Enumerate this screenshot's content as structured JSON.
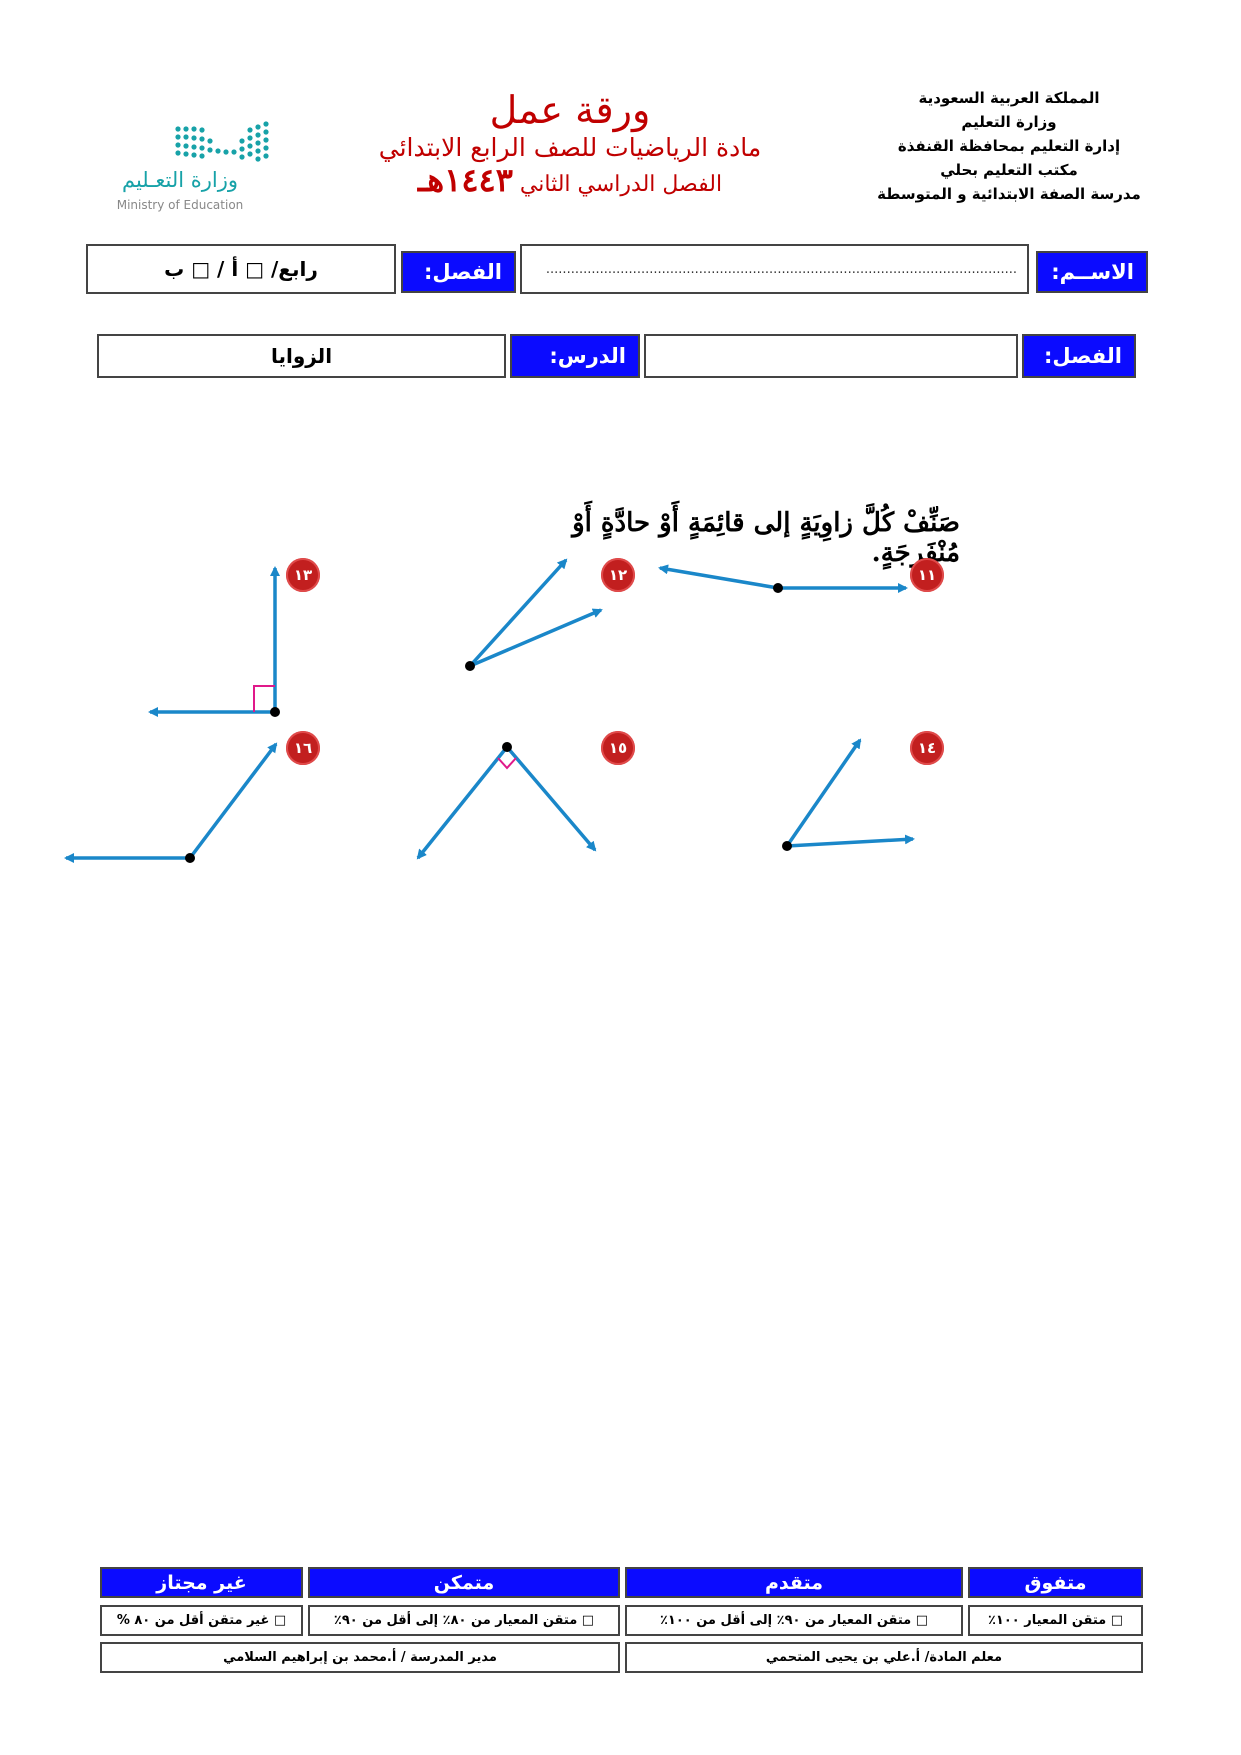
{
  "header": {
    "school_lines": [
      "المملكة العربية السعودية",
      "وزارة التعليم",
      "إدارة التعليم بمحافظة القنفذة",
      "مكتب التعليم بحلي",
      "مدرسة الصفة الابتدائية و المتوسطة"
    ],
    "worksheet_title": "ورقة عمل",
    "subject_line": "مادة الرياضيات للصف الرابع الابتدائي",
    "semester_text": "الفصل الدراسي الثاني",
    "year_text": "١٤٤٣هـ",
    "logo_ar": "وزارة التعـليم",
    "logo_en": "Ministry of Education"
  },
  "form": {
    "name_label": "الاســم:",
    "name_value": "..................................................................................................................",
    "class_label": "الفصل:",
    "class_value": "رابع/ □ أ  /  □ ب",
    "semester_label": "الفصل:",
    "semester_value": "",
    "lesson_label": "الدرس:",
    "lesson_value": "الزوايا"
  },
  "exercise": {
    "instruction": "صَنِّفْ كُلَّ زاوِيَةٍ إلى قائِمَةٍ أَوْ حادَّةٍ أَوْ مُنْفَرِجَةٍ.",
    "items": [
      {
        "number": "١١"
      },
      {
        "number": "١٢"
      },
      {
        "number": "١٣"
      },
      {
        "number": "١٤"
      },
      {
        "number": "١٥"
      },
      {
        "number": "١٦"
      }
    ],
    "arrow_color": "#1a87c9",
    "right_angle_color": "#e0198a"
  },
  "assessment": {
    "headers": [
      "متفوق",
      "متقدم",
      "متمكن",
      "غير مجتاز"
    ],
    "criteria": [
      "□ متقن المعيار ١٠٠٪",
      "□ متقن المعيار من ٩٠٪  إلى أقل من ١٠٠٪",
      "□ متقن المعيار من ٨٠٪ إلى أقل من ٩٠٪",
      "□ غير متقن أقل من ٨٠ %"
    ],
    "teacher": "معلم المادة/ أ.علي بن يحيى المتحمي",
    "principal": "مدير المدرسة / أ.محمد بن إبراهيم السلامي"
  },
  "colors": {
    "label_bg": "#0b0bff",
    "title_red": "#c00000",
    "badge_red": "#c21f1f"
  }
}
